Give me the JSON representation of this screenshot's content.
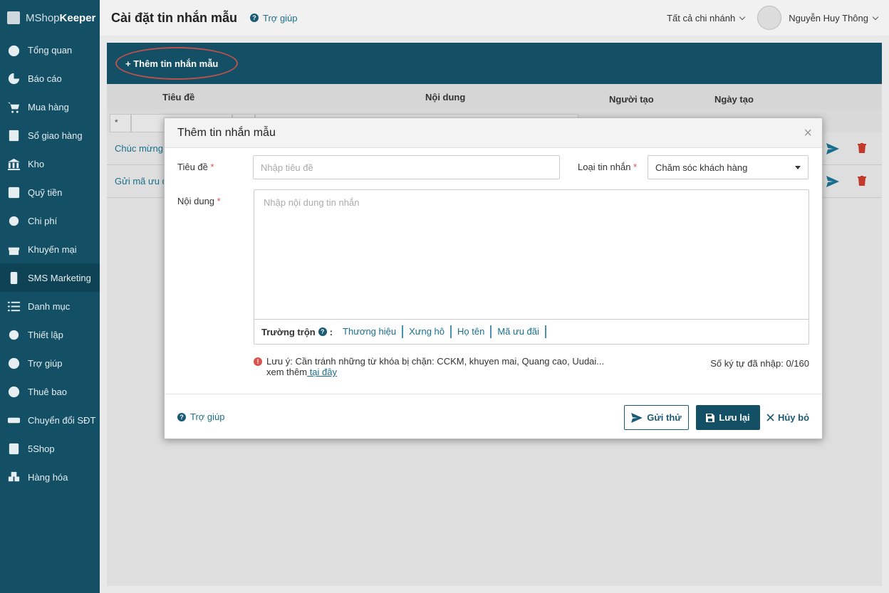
{
  "app": {
    "logo_light": "MShop",
    "logo_bold": "Keeper"
  },
  "sidebar": {
    "items": [
      {
        "label": "Tổng quan",
        "icon": "dashboard-icon"
      },
      {
        "label": "Báo cáo",
        "icon": "pie-chart-icon"
      },
      {
        "label": "Mua hàng",
        "icon": "cart-icon"
      },
      {
        "label": "Sổ giao hàng",
        "icon": "delivery-book-icon"
      },
      {
        "label": "Kho",
        "icon": "warehouse-icon"
      },
      {
        "label": "Quỹ tiền",
        "icon": "safe-icon"
      },
      {
        "label": "Chi phí",
        "icon": "expense-icon"
      },
      {
        "label": "Khuyến mại",
        "icon": "gift-icon"
      },
      {
        "label": "SMS Marketing",
        "icon": "mobile-icon"
      },
      {
        "label": "Danh mục",
        "icon": "list-icon"
      },
      {
        "label": "Thiết lập",
        "icon": "gear-icon"
      },
      {
        "label": "Trợ giúp",
        "icon": "help-icon"
      },
      {
        "label": "Thuê bao",
        "icon": "user-icon"
      },
      {
        "label": "Chuyển đổi SĐT",
        "icon": "phone-convert-icon"
      },
      {
        "label": "5Shop",
        "icon": "5shop-icon"
      },
      {
        "label": "Hàng hóa",
        "icon": "cubes-icon"
      }
    ]
  },
  "header": {
    "title": "Cài đặt tin nhắn mẫu",
    "help": "Trợ giúp",
    "branch": "Tất cả chi nhánh",
    "user": "Nguyễn Huy Thông"
  },
  "toolbar": {
    "add_label": "+ Thêm tin nhắn mẫu"
  },
  "table": {
    "columns": [
      "Tiêu đề",
      "Nội dung",
      "Người tạo",
      "Ngày tạo"
    ],
    "filter_first": "*",
    "rows": [
      "Chúc mừng",
      "Gửi mã ưu đ"
    ]
  },
  "modal": {
    "title": "Thêm tin nhắn mẫu",
    "close": "×",
    "title_label": "Tiêu đề",
    "title_placeholder": "Nhập tiêu đề",
    "type_label": "Loại tin nhắn",
    "type_value": "Chăm sóc khách hàng",
    "content_label": "Nội dung",
    "content_placeholder": "Nhập nội dung tin nhắn",
    "required_mark": "*",
    "mix_label": "Trường trộn",
    "mix_fields": [
      "Thương hiệu",
      "Xưng hô",
      "Họ tên",
      "Mã ưu đãi"
    ],
    "note_text": "Lưu ý: Cần tránh những từ khóa bị chặn: CCKM, khuyen mai, Quang cao, Uudai...",
    "note_more": "xem thêm",
    "note_link": " tại đây",
    "counter": "Số ký tự đã nhập: 0/160",
    "help": "Trợ giúp",
    "test_button": "Gửi thử",
    "save_button": "Lưu lại",
    "cancel_button": "Hủy bỏ"
  },
  "colors": {
    "brand": "#134f65",
    "link": "#1a6e8d",
    "danger": "#d9534f"
  }
}
